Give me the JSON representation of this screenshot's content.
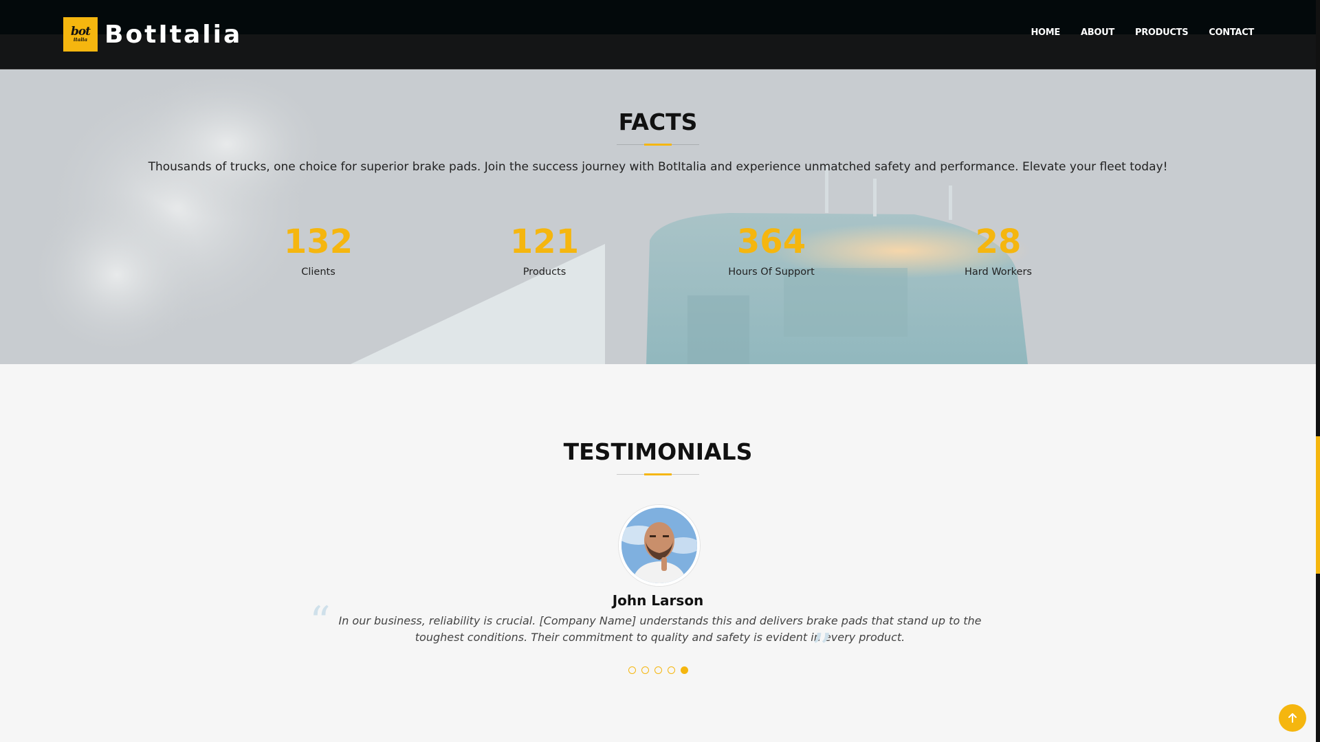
{
  "brand": {
    "name": "BotItalia",
    "badge_top": "bot",
    "badge_bottom": "italia"
  },
  "nav": {
    "items": [
      {
        "label": "HOME"
      },
      {
        "label": "ABOUT"
      },
      {
        "label": "PRODUCTS"
      },
      {
        "label": "CONTACT"
      }
    ]
  },
  "facts": {
    "title": "FACTS",
    "description": "Thousands of trucks, one choice for superior brake pads. Join the success journey with BotItalia and experience unmatched safety and performance. Elevate your fleet today!",
    "counters": [
      {
        "value": "132",
        "label": "Clients"
      },
      {
        "value": "121",
        "label": "Products"
      },
      {
        "value": "364",
        "label": "Hours Of Support"
      },
      {
        "value": "28",
        "label": "Hard Workers"
      }
    ]
  },
  "testimonials": {
    "title": "TESTIMONIALS",
    "name": "John Larson",
    "quote": "In our business, reliability is crucial. [Company Name] understands this and delivers brake pads that stand up to the toughest conditions. Their commitment to quality and safety is evident in every product.",
    "open_quote": "“",
    "close_quote": "”",
    "dots_count": 5,
    "active_dot": 5
  },
  "colors": {
    "accent": "#f5b60f",
    "header_bg": "#03090b",
    "page_bg": "#f6f6f6"
  },
  "icons": {
    "back_to_top": "arrow-up-icon"
  }
}
